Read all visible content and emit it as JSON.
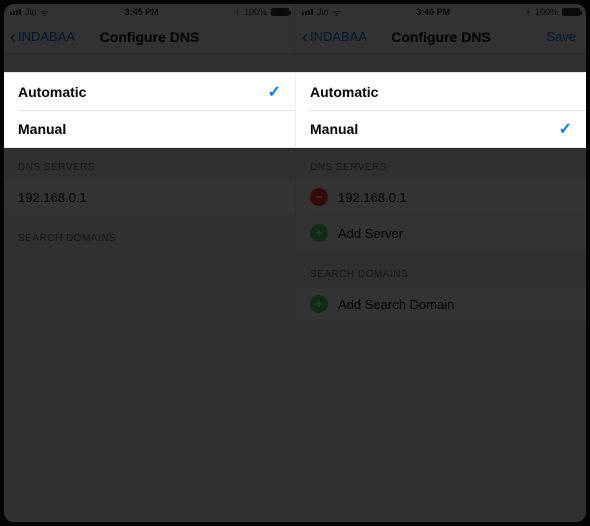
{
  "left": {
    "status": {
      "carrier": "Jio",
      "time": "3:45 PM",
      "battery": "100%"
    },
    "nav": {
      "back": "INDABAA",
      "title": "Configure DNS"
    },
    "selection": {
      "automatic": "Automatic",
      "manual": "Manual",
      "selected": "automatic"
    },
    "dns": {
      "header": "DNS SERVERS",
      "servers": [
        "192.168.0.1"
      ]
    },
    "search": {
      "header": "SEARCH DOMAINS"
    }
  },
  "right": {
    "status": {
      "carrier": "Jio",
      "time": "3:46 PM",
      "battery": "100%"
    },
    "nav": {
      "back": "INDABAA",
      "title": "Configure DNS",
      "save": "Save"
    },
    "selection": {
      "automatic": "Automatic",
      "manual": "Manual",
      "selected": "manual"
    },
    "dns": {
      "header": "DNS SERVERS",
      "servers": [
        "192.168.0.1"
      ],
      "add": "Add Server"
    },
    "search": {
      "header": "SEARCH DOMAINS",
      "add": "Add Search Domain"
    }
  }
}
